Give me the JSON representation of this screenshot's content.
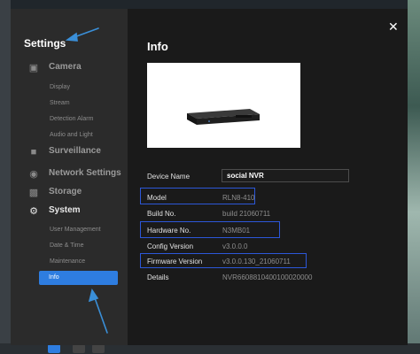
{
  "sidebar": {
    "title": "Settings",
    "categories": [
      {
        "label": "Camera",
        "icon": "camera-icon"
      },
      {
        "label": "Surveillance",
        "icon": "surveillance-icon"
      },
      {
        "label": "Network Settings",
        "icon": "globe-icon"
      },
      {
        "label": "Storage",
        "icon": "storage-icon"
      },
      {
        "label": "System",
        "icon": "gear-icon"
      }
    ],
    "camera_subs": [
      "Display",
      "Stream",
      "Detection Alarm",
      "Audio and Light"
    ],
    "system_subs": [
      "User Management",
      "Date & Time",
      "Maintenance",
      "Info"
    ],
    "active_item": "Info"
  },
  "main": {
    "title": "Info",
    "close_icon": "close-icon",
    "device_name_label": "Device Name",
    "device_name_value": "social NVR",
    "rows": [
      {
        "label": "Model",
        "value": "RLN8-410"
      },
      {
        "label": "Build No.",
        "value": "build 21060711"
      },
      {
        "label": "Hardware No.",
        "value": "N3MB01"
      },
      {
        "label": "Config Version",
        "value": "v3.0.0.0"
      },
      {
        "label": "Firmware Version",
        "value": "v3.0.0.130_21060711"
      },
      {
        "label": "Details",
        "value": "NVR6608810400100020000"
      }
    ]
  },
  "colors": {
    "accent": "#2e7de0",
    "highlight_box": "#2c57d8",
    "annotation_arrow": "#3a8fd8"
  }
}
